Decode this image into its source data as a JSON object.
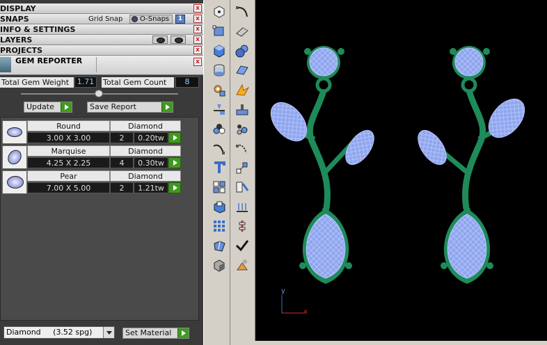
{
  "panels": {
    "display": "DISPLAY",
    "snaps": "SNAPS",
    "info": "INFO & SETTINGS",
    "layers": "LAYERS",
    "projects": "PROJECTS",
    "close": "x"
  },
  "snaps": {
    "grid_snap": "Grid Snap",
    "osnaps": "O-Snaps",
    "toggle": "1"
  },
  "gem_reporter": {
    "title": "GEM REPORTER",
    "weight_label": "Total Gem Weight",
    "weight_value": "1.71",
    "count_label": "Total Gem Count",
    "count_value": "8",
    "update": "Update",
    "save_report": "Save Report",
    "rows": [
      {
        "shape": "Round",
        "size": "3.00 X 3.00",
        "material": "Diamond",
        "count": "2",
        "weight": "0.20tw"
      },
      {
        "shape": "Marquise",
        "size": "4.25 X 2.25",
        "material": "Diamond",
        "count": "4",
        "weight": "0.30tw"
      },
      {
        "shape": "Pear",
        "size": "7.00 X 5.00",
        "material": "Diamond",
        "count": "2",
        "weight": "1.21tw"
      }
    ]
  },
  "material": {
    "selected": "Diamond     (3.52 spg)",
    "set_material": "Set Material"
  },
  "viewport": {
    "axis_y": "y",
    "axis_x": "x"
  },
  "colors": {
    "gem_blue": "#8fa6ee",
    "metal_green": "#1f8a5a",
    "viewport_bg": "#000000"
  }
}
